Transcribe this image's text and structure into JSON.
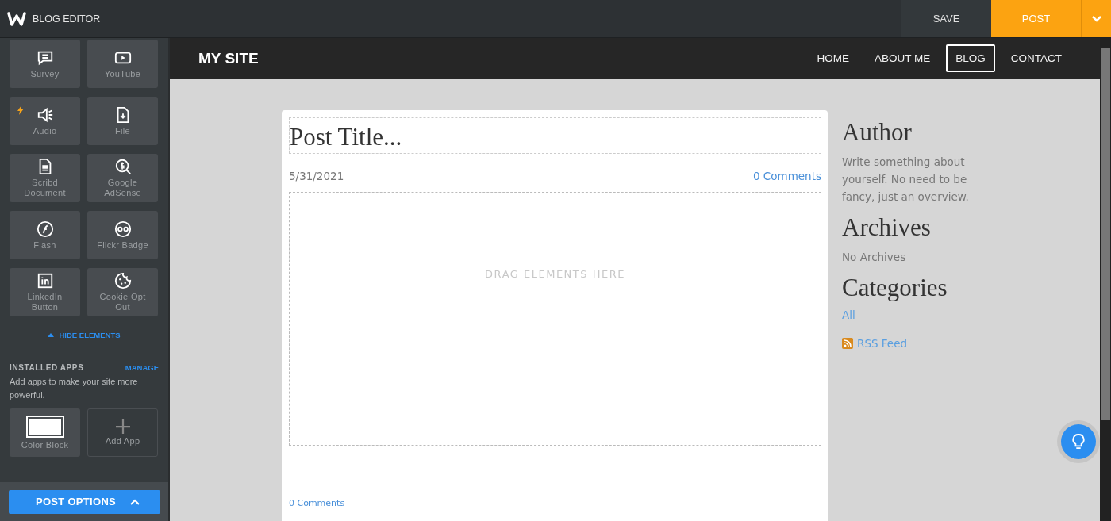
{
  "app_bar": {
    "title": "BLOG EDITOR",
    "save": "SAVE",
    "post": "POST"
  },
  "sidebar": {
    "elements": [
      {
        "label": "Survey",
        "flagged": false
      },
      {
        "label": "YouTube",
        "flagged": false
      },
      {
        "label": "Audio",
        "flagged": true
      },
      {
        "label": "File",
        "flagged": false
      },
      {
        "label": "Scribd Document",
        "flagged": false
      },
      {
        "label": "Google AdSense",
        "flagged": false
      },
      {
        "label": "Flash",
        "flagged": false
      },
      {
        "label": "Flickr Badge",
        "flagged": false
      },
      {
        "label": "LinkedIn Button",
        "flagged": false
      },
      {
        "label": "Cookie Opt Out",
        "flagged": false
      }
    ],
    "hide_elements": "HIDE ELEMENTS",
    "installed_apps": {
      "heading": "INSTALLED APPS",
      "manage": "MANAGE",
      "text": "Add apps to make your site more powerful.",
      "apps": [
        {
          "label": "Color Block",
          "kind": "app"
        },
        {
          "label": "Add App",
          "kind": "add"
        }
      ]
    },
    "post_options": "POST OPTIONS"
  },
  "site": {
    "name": "MY SITE",
    "nav": [
      {
        "label": "HOME",
        "selected": false
      },
      {
        "label": "ABOUT ME",
        "selected": false
      },
      {
        "label": "BLOG",
        "selected": true
      },
      {
        "label": "CONTACT",
        "selected": false
      }
    ]
  },
  "post": {
    "title": "Post Title...",
    "date": "5/31/2021",
    "comments_top": "0 Comments",
    "drop_hint": "DRAG ELEMENTS HERE",
    "comments_bottom": "0 Comments"
  },
  "blog_sidebar": {
    "author_heading": "Author",
    "author_text": "Write something about yourself. No need to be fancy, just an overview.",
    "archives_heading": "Archives",
    "archives_text": "No Archives",
    "categories_heading": "Categories",
    "category": "All",
    "rss": "RSS Feed"
  }
}
